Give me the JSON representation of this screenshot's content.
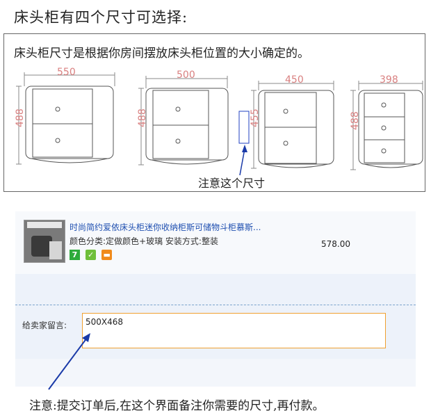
{
  "heading": "床头柜有四个尺寸可选择:",
  "subtitle": "床头柜尺寸是根据你房间摆放床头柜位置的大小确定的。",
  "sizes": [
    {
      "width": "550",
      "height": "488"
    },
    {
      "width": "500",
      "height": "488"
    },
    {
      "width": "450",
      "height": "455"
    },
    {
      "width": "398",
      "height": "488"
    }
  ],
  "note_dimension": "注意这个尺寸",
  "product": {
    "title": "时尚简约爱依床头柜迷你收纳柜斯可储物斗柜慕斯...",
    "desc": "颜色分类:定做颜色+玻璃  安装方式:整装",
    "badge_7": "7",
    "price": "578.00"
  },
  "message": {
    "label": "给卖家留言:",
    "value": "500X468"
  },
  "note_bottom": "注意:提交订单后,在这个界面备注你需要的尺寸,再付款。",
  "colors": {
    "dimension": "#d98080",
    "arrow": "#1a3aa8",
    "input_border": "#f0a030"
  }
}
